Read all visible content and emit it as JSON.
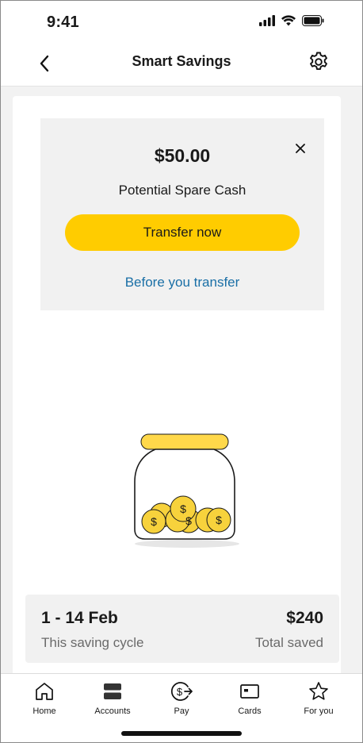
{
  "status_bar": {
    "time": "9:41"
  },
  "header": {
    "title": "Smart Savings",
    "back_icon": "chevron-left-icon",
    "settings_icon": "gear-icon"
  },
  "promo": {
    "amount": "$50.00",
    "label": "Potential Spare Cash",
    "transfer_button": "Transfer now",
    "link": "Before you transfer",
    "close_icon": "close-icon"
  },
  "illustration": {
    "name": "savings-jar",
    "coin_symbol": "$"
  },
  "summary": {
    "cycle_range": "1 - 14 Feb",
    "cycle_label": "This saving cycle",
    "total_amount": "$240",
    "total_label": "Total saved"
  },
  "tabs": [
    {
      "label": "Home",
      "icon": "home-icon"
    },
    {
      "label": "Accounts",
      "icon": "accounts-icon"
    },
    {
      "label": "Pay",
      "icon": "pay-icon"
    },
    {
      "label": "Cards",
      "icon": "card-icon"
    },
    {
      "label": "For you",
      "icon": "star-icon"
    }
  ],
  "colors": {
    "accent": "#ffcc00",
    "link": "#1a6fa6",
    "panel": "#f1f1f1",
    "background": "#f2f2f2"
  }
}
